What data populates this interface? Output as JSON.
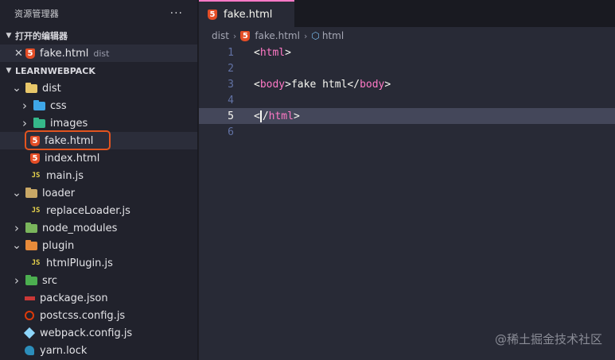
{
  "sidebar": {
    "title": "资源管理器",
    "more": "···",
    "open_editors": {
      "label": "打开的编辑器",
      "items": [
        {
          "name": "fake.html",
          "dir": "dist",
          "icon": "html5-icon"
        }
      ]
    },
    "project": {
      "label": "LEARNWEBPACK",
      "tree": [
        {
          "name": "dist",
          "type": "folder",
          "expanded": true,
          "icon": "dist-folder-icon",
          "color": "#e8c76a"
        },
        {
          "name": "css",
          "type": "folder",
          "expanded": false,
          "icon": "css-folder-icon",
          "color": "#3fa7e8"
        },
        {
          "name": "images",
          "type": "folder",
          "expanded": false,
          "icon": "images-folder-icon",
          "color": "#35b88a"
        },
        {
          "name": "fake.html",
          "type": "file",
          "icon": "html5-icon",
          "selected": true
        },
        {
          "name": "index.html",
          "type": "file",
          "icon": "html5-icon"
        },
        {
          "name": "main.js",
          "type": "file",
          "icon": "js-icon"
        },
        {
          "name": "loader",
          "type": "folder",
          "expanded": true,
          "icon": "loader-folder-icon",
          "color": "#c9a866"
        },
        {
          "name": "replaceLoader.js",
          "type": "file",
          "icon": "js-icon"
        },
        {
          "name": "node_modules",
          "type": "folder",
          "expanded": false,
          "icon": "node-folder-icon",
          "color": "#7ab55c"
        },
        {
          "name": "plugin",
          "type": "folder",
          "expanded": true,
          "icon": "plugin-folder-icon",
          "color": "#e88b3a"
        },
        {
          "name": "htmlPlugin.js",
          "type": "file",
          "icon": "js-icon"
        },
        {
          "name": "src",
          "type": "folder",
          "expanded": false,
          "icon": "src-folder-icon",
          "color": "#4caf50"
        },
        {
          "name": "package.json",
          "type": "file",
          "icon": "npm-icon"
        },
        {
          "name": "postcss.config.js",
          "type": "file",
          "icon": "postcss-icon"
        },
        {
          "name": "webpack.config.js",
          "type": "file",
          "icon": "webpack-icon"
        },
        {
          "name": "yarn.lock",
          "type": "file",
          "icon": "yarn-icon"
        }
      ]
    }
  },
  "editor": {
    "tab": {
      "name": "fake.html",
      "icon": "html5-icon"
    },
    "breadcrumb": [
      "dist",
      "fake.html",
      "html"
    ],
    "lines": [
      {
        "num": "1",
        "code": "<html>"
      },
      {
        "num": "2",
        "code": ""
      },
      {
        "num": "3",
        "code": "<body>fake html</body>"
      },
      {
        "num": "4",
        "code": ""
      },
      {
        "num": "5",
        "code": "</html>",
        "current": true
      },
      {
        "num": "6",
        "code": ""
      }
    ]
  },
  "watermark": "@稀土掘金技术社区",
  "colors": {
    "accent": "#ff79c6",
    "highlight": "#e3541f",
    "html": "#e44d26",
    "js": "#e8d44d"
  }
}
